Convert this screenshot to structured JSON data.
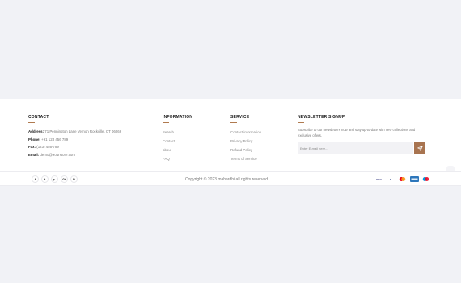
{
  "contact": {
    "heading": "CONTACT",
    "address_label": "Address:",
    "address_value": "71 Pennington Lane Vernon Rockville, CT 06066",
    "phone_label": "Phone:",
    "phone_value": "+91 123 456 789",
    "fax_label": "Fax:",
    "fax_value": "(123) 456-789",
    "email_label": "Email:",
    "email_value": "demo@Yourstore.com"
  },
  "information": {
    "heading": "INFORMATION",
    "links": [
      "Search",
      "Contact",
      "about",
      "FAQ"
    ]
  },
  "service": {
    "heading": "SERVICE",
    "links": [
      "Contact information",
      "Privacy Policy",
      "Refund Policy",
      "Terms of Service"
    ]
  },
  "newsletter": {
    "heading": "NEWSLETTER SIGNUP",
    "text": "Subscribe to our newsletters now and stay up-to-date with new collections and exclusive offers.",
    "placeholder": "Enter E-mail here...",
    "button_icon": "send-icon"
  },
  "bottom": {
    "socials": [
      {
        "icon": "facebook-icon",
        "glyph": "f"
      },
      {
        "icon": "twitter-icon",
        "glyph": "t"
      },
      {
        "icon": "youtube-icon",
        "glyph": "▶"
      },
      {
        "icon": "google-plus-icon",
        "glyph": "G+"
      },
      {
        "icon": "pinterest-icon",
        "glyph": "P"
      }
    ],
    "copyright": "Copyright © 2023 mahardhi all rights reserved",
    "payments": [
      {
        "icon": "visa-icon",
        "label": "VISA"
      },
      {
        "icon": "paypal-icon",
        "label": "P"
      },
      {
        "icon": "mastercard-icon",
        "label": ""
      },
      {
        "icon": "amex-icon",
        "label": ""
      },
      {
        "icon": "maestro-icon",
        "label": ""
      }
    ]
  },
  "colors": {
    "accent": "#a87450",
    "page_background": "#f1f2f6",
    "footer_background": "#ffffff"
  }
}
